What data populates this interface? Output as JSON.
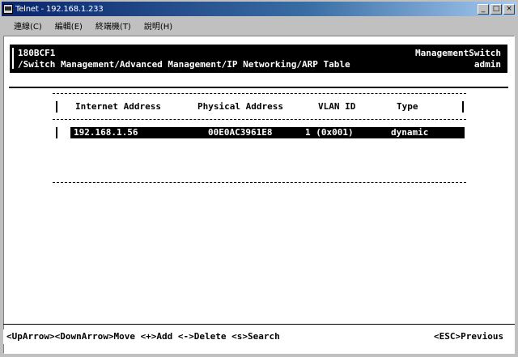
{
  "window": {
    "title": "Telnet - 192.168.1.233",
    "buttons": [
      "_",
      "□",
      "×"
    ]
  },
  "menubar": {
    "items": [
      "連線(C)",
      "編輯(E)",
      "終端機(T)",
      "說明(H)"
    ]
  },
  "header": {
    "device_name": "180BCF1",
    "device_type": "ManagementSwitch",
    "path": "/Switch Management/Advanced Management/IP Networking/ARP Table",
    "user": "admin"
  },
  "table": {
    "columns": {
      "ip": "Internet Address",
      "mac": "Physical Address",
      "vlan": "VLAN ID",
      "type": "Type"
    },
    "rows": [
      {
        "ip": "192.168.1.56",
        "mac": "00E0AC3961E8",
        "vlan": "1 (0x001)",
        "type": "dynamic"
      }
    ]
  },
  "footer": {
    "keys": "<UpArrow><DownArrow>Move <+>Add <->Delete <s>Search",
    "escape": "<ESC>Previous"
  },
  "colors": {
    "title_gradient_start": "#0a246a",
    "title_gradient_end": "#a6caf0",
    "window_bg": "#c0c0c0",
    "terminal_bg": "#ffffff",
    "highlight_bg": "#000000",
    "highlight_fg": "#ffffff"
  }
}
